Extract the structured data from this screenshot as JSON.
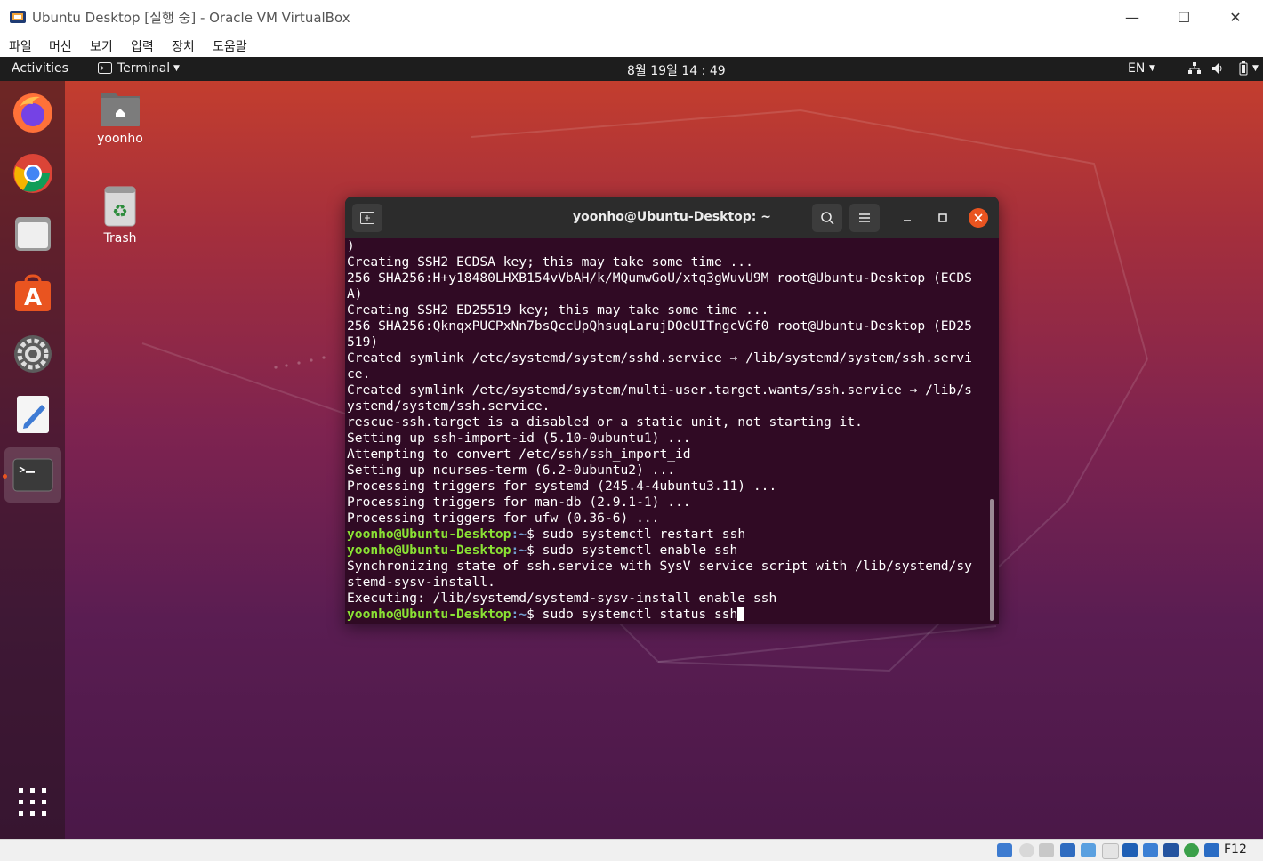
{
  "window": {
    "title": "Ubuntu Desktop [실행 중] - Oracle VM VirtualBox",
    "icon": "virtualbox-icon",
    "controls": {
      "minimize": "—",
      "maximize": "☐",
      "close": "✕"
    }
  },
  "menu": [
    "파일",
    "머신",
    "보기",
    "입력",
    "장치",
    "도움말"
  ],
  "topbar": {
    "activities": "Activities",
    "app_menu": "Terminal",
    "clock": "8월 19일  14 : 49",
    "input_lang": "EN",
    "tray_icons": [
      "network-icon",
      "volume-icon",
      "battery-icon",
      "power-menu-icon"
    ]
  },
  "dock": {
    "items": [
      "firefox-icon",
      "chrome-icon",
      "files-icon",
      "software-center-icon",
      "settings-icon",
      "text-editor-icon",
      "terminal-icon"
    ],
    "show_apps": "apps-grid-icon"
  },
  "desktop": {
    "icons": [
      {
        "label": "yoonho",
        "icon": "home-folder-icon"
      },
      {
        "label": "Trash",
        "icon": "trash-icon"
      }
    ]
  },
  "terminal": {
    "title": "yoonho@Ubuntu-Desktop: ~",
    "prompt_user": "yoonho@Ubuntu-Desktop",
    "prompt_path": ":~",
    "prompt_sign": "$ ",
    "lines": [
      ")",
      "Creating SSH2 ECDSA key; this may take some time ...",
      "256 SHA256:H+y18480LHXB154vVbAH/k/MQumwGoU/xtq3gWuvU9M root@Ubuntu-Desktop (ECDS",
      "A)",
      "Creating SSH2 ED25519 key; this may take some time ...",
      "256 SHA256:QknqxPUCPxNn7bsQccUpQhsuqLarujDOeUITngcVGf0 root@Ubuntu-Desktop (ED25",
      "519)",
      "Created symlink /etc/systemd/system/sshd.service → /lib/systemd/system/ssh.servi",
      "ce.",
      "Created symlink /etc/systemd/system/multi-user.target.wants/ssh.service → /lib/s",
      "ystemd/system/ssh.service.",
      "rescue-ssh.target is a disabled or a static unit, not starting it.",
      "Setting up ssh-import-id (5.10-0ubuntu1) ...",
      "Attempting to convert /etc/ssh/ssh_import_id",
      "Setting up ncurses-term (6.2-0ubuntu2) ...",
      "Processing triggers for systemd (245.4-4ubuntu3.11) ...",
      "Processing triggers for man-db (2.9.1-1) ...",
      "Processing triggers for ufw (0.36-6) ..."
    ],
    "cmd1": "sudo systemctl restart ssh",
    "cmd2": "sudo systemctl enable ssh",
    "after_lines": [
      "Synchronizing state of ssh.service with SysV service script with /lib/systemd/sy",
      "stemd-sysv-install.",
      "Executing: /lib/systemd/systemd-sysv-install enable ssh"
    ],
    "current_cmd": "sudo systemctl status ssh"
  },
  "statusbar": {
    "host_key": "F12",
    "icons": [
      "hdd-icon",
      "optical-icon",
      "audio-icon",
      "network-icon",
      "usb-icon",
      "shared-folder-icon",
      "display-icon",
      "recording-icon",
      "vt-x-icon",
      "mouse-integration-icon",
      "keyboard-icon"
    ]
  }
}
